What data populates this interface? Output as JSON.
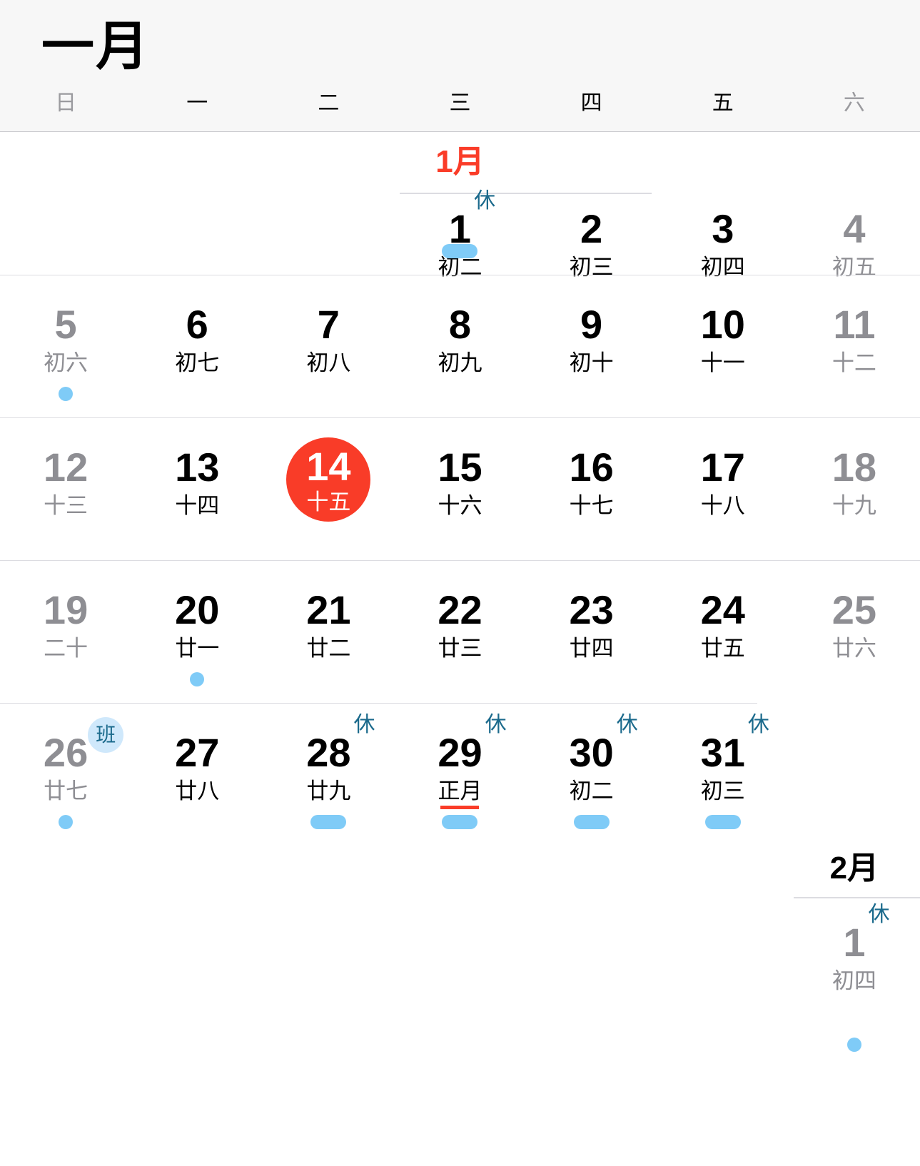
{
  "app": {
    "name": "calendar-month-view"
  },
  "header": {
    "title": "一月"
  },
  "weekdays": [
    {
      "label": "日",
      "weekend": true
    },
    {
      "label": "一",
      "weekend": false
    },
    {
      "label": "二",
      "weekend": false
    },
    {
      "label": "三",
      "weekend": false
    },
    {
      "label": "四",
      "weekend": false
    },
    {
      "label": "五",
      "weekend": false
    },
    {
      "label": "六",
      "weekend": true
    }
  ],
  "month_tags": {
    "january": "1月",
    "february": "2月"
  },
  "badges": {
    "rest": "休",
    "work": "班"
  },
  "colors": {
    "selected_day_bg": "#f93c28",
    "month_tag_current": "#fa3c28",
    "rest_badge_text": "#1b6a8c",
    "work_badge_text": "#1b6a8c",
    "work_badge_bg": "#cfe8fb",
    "event_indicator": "#7fcbf7",
    "lunar_new_year_underline": "#fa3c28",
    "dim_text": "#8e8e93",
    "header_bg": "#f7f7f7",
    "separator": "#dcdce1"
  },
  "weeks": [
    {
      "id": "week-1",
      "cells": [
        {
          "empty": true
        },
        {
          "empty": true
        },
        {
          "empty": true
        },
        {
          "day": "1",
          "lunar": "初二",
          "dim": false,
          "badge": "休",
          "badge_type": "rest",
          "indicator": "pill",
          "month_tag": "1月",
          "month_tag_color": "red"
        },
        {
          "day": "2",
          "lunar": "初三",
          "dim": false
        },
        {
          "day": "3",
          "lunar": "初四",
          "dim": false
        },
        {
          "day": "4",
          "lunar": "初五",
          "dim": true
        }
      ]
    },
    {
      "id": "week-2",
      "cells": [
        {
          "day": "5",
          "lunar": "初六",
          "dim": true,
          "indicator": "dot"
        },
        {
          "day": "6",
          "lunar": "初七",
          "dim": false
        },
        {
          "day": "7",
          "lunar": "初八",
          "dim": false
        },
        {
          "day": "8",
          "lunar": "初九",
          "dim": false
        },
        {
          "day": "9",
          "lunar": "初十",
          "dim": false
        },
        {
          "day": "10",
          "lunar": "十一",
          "dim": false
        },
        {
          "day": "11",
          "lunar": "十二",
          "dim": true
        }
      ]
    },
    {
      "id": "week-3",
      "cells": [
        {
          "day": "12",
          "lunar": "十三",
          "dim": true
        },
        {
          "day": "13",
          "lunar": "十四",
          "dim": false
        },
        {
          "day": "14",
          "lunar": "十五",
          "dim": false,
          "selected": true
        },
        {
          "day": "15",
          "lunar": "十六",
          "dim": false
        },
        {
          "day": "16",
          "lunar": "十七",
          "dim": false
        },
        {
          "day": "17",
          "lunar": "十八",
          "dim": false
        },
        {
          "day": "18",
          "lunar": "十九",
          "dim": true
        }
      ]
    },
    {
      "id": "week-4",
      "cells": [
        {
          "day": "19",
          "lunar": "二十",
          "dim": true
        },
        {
          "day": "20",
          "lunar": "廿一",
          "dim": false,
          "indicator": "dot"
        },
        {
          "day": "21",
          "lunar": "廿二",
          "dim": false
        },
        {
          "day": "22",
          "lunar": "廿三",
          "dim": false
        },
        {
          "day": "23",
          "lunar": "廿四",
          "dim": false
        },
        {
          "day": "24",
          "lunar": "廿五",
          "dim": false
        },
        {
          "day": "25",
          "lunar": "廿六",
          "dim": true
        }
      ]
    },
    {
      "id": "week-5",
      "cells": [
        {
          "day": "26",
          "lunar": "廿七",
          "dim": true,
          "badge": "班",
          "badge_type": "work",
          "indicator": "dot"
        },
        {
          "day": "27",
          "lunar": "廿八",
          "dim": false
        },
        {
          "day": "28",
          "lunar": "廿九",
          "dim": false,
          "badge": "休",
          "badge_type": "rest",
          "indicator": "pill"
        },
        {
          "day": "29",
          "lunar": "正月",
          "dim": false,
          "badge": "休",
          "badge_type": "rest",
          "indicator": "pill",
          "lunar_underline": true
        },
        {
          "day": "30",
          "lunar": "初二",
          "dim": false,
          "badge": "休",
          "badge_type": "rest",
          "indicator": "pill"
        },
        {
          "day": "31",
          "lunar": "初三",
          "dim": false,
          "badge": "休",
          "badge_type": "rest",
          "indicator": "pill"
        },
        {
          "empty": true
        }
      ]
    }
  ],
  "february": {
    "label": "2月",
    "cells": [
      {
        "empty": true
      },
      {
        "empty": true
      },
      {
        "empty": true
      },
      {
        "empty": true
      },
      {
        "empty": true
      },
      {
        "empty": true
      },
      {
        "day": "1",
        "lunar": "初四",
        "dim": true,
        "badge": "休",
        "badge_type": "rest",
        "indicator": "dot"
      }
    ]
  }
}
